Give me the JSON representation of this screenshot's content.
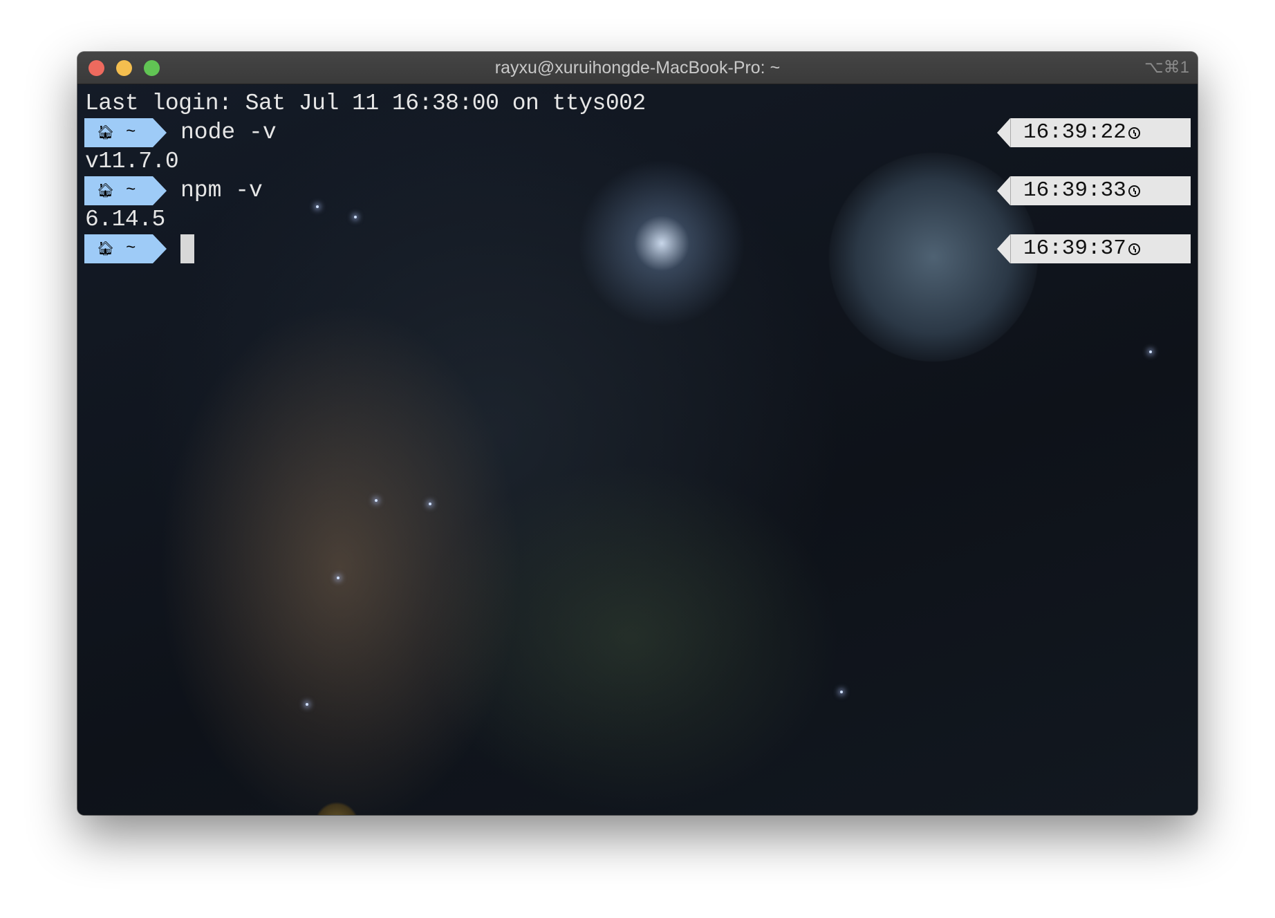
{
  "window": {
    "title": "rayxu@xuruihongde-MacBook-Pro: ~",
    "shortcut": "⌥⌘1"
  },
  "terminal": {
    "last_login": "Last login: Sat Jul 11 16:38:00 on ttys002",
    "prompt": {
      "icon": "home-icon",
      "home_glyph": "🏠︎",
      "dir": "~",
      "color": "#9ecbf7"
    },
    "entries": [
      {
        "command": "node -v",
        "output": "v11.7.0",
        "time": "16:39:22"
      },
      {
        "command": "npm -v",
        "output": "6.14.5",
        "time": "16:39:33"
      },
      {
        "command": "",
        "time": "16:39:37"
      }
    ]
  }
}
